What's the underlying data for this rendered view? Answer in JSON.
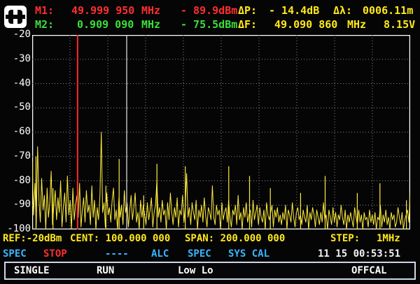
{
  "header": {
    "m1_label": "M1:",
    "m1_freq": "49.999 950",
    "m1_freq_unit": "MHz",
    "m1_level": "- 89.9dBm",
    "delta_p_label": "ΔP:",
    "delta_p_value": "- 14.4dB",
    "delta_lambda_label": "Δλ:",
    "delta_lambda_value": "0006.11m",
    "m2_label": "M2:",
    "m2_freq": "0.909 090",
    "m2_freq_unit": "MHz",
    "m2_level": "- 75.5dBm",
    "delta_f_label": "ΔF:",
    "delta_f_value": "49.090 860",
    "delta_f_unit": "MHz",
    "battery_voltage": "8.15V"
  },
  "chart_data": {
    "type": "line",
    "title": "",
    "xlabel": "",
    "ylabel": "",
    "y_ticks": [
      "-20",
      "-30",
      "-40",
      "-50",
      "-60",
      "-70",
      "-80",
      "-90",
      "-100"
    ],
    "ylim": [
      -100,
      -20
    ],
    "xlim": [
      0,
      200
    ],
    "grid": true,
    "series": [
      {
        "values": [
          -72,
          -94,
          -81,
          -99,
          -66,
          -88,
          -97,
          -79,
          -92,
          -86,
          -100,
          -83,
          -95,
          -89,
          -76,
          -98,
          -90,
          -84,
          -96,
          -87,
          -93,
          -80,
          -99,
          -91,
          -85,
          -97,
          -78,
          -94,
          -88,
          -100,
          -83,
          -96,
          -90,
          -86,
          -95,
          -81,
          -99,
          -92,
          -87,
          -97,
          -84,
          -93,
          -90,
          -98,
          -82,
          -95,
          -88,
          -100,
          -91,
          -96,
          -86,
          -60,
          -93,
          -89,
          -99,
          -85,
          -94,
          -91,
          -97,
          -88,
          -83,
          -96,
          -92,
          -100,
          -87,
          -95,
          -90,
          -98,
          -84,
          -93,
          -89,
          -99,
          -92,
          -86,
          -96,
          -91,
          -85,
          -97,
          -93,
          -100,
          -88,
          -95,
          -90,
          -94,
          -98,
          -89,
          -96,
          -92,
          -87,
          -99,
          -93,
          -90,
          -80,
          -95,
          -91,
          -97,
          -88,
          -94,
          -92,
          -100,
          -89,
          -96,
          -85,
          -93,
          -98,
          -91,
          -95,
          -87,
          -99,
          -92,
          -94,
          -86,
          -97,
          -90,
          -77,
          -95,
          -91,
          -98,
          -89,
          -93,
          -96,
          -88,
          -100,
          -92,
          -95,
          -90,
          -97,
          -87,
          -94,
          -99,
          -91,
          -93,
          -96,
          -82,
          -95,
          -98,
          -90,
          -94,
          -92,
          -100,
          -89,
          -96,
          -93,
          -91,
          -97,
          -88,
          -95,
          -99,
          -92,
          -94,
          -90,
          -98,
          -86,
          -96,
          -93,
          -100,
          -91,
          -95,
          -89,
          -97,
          -94,
          -92,
          -99,
          -88,
          -96,
          -93,
          -90,
          -98,
          -91,
          -95,
          -97,
          -92,
          -100,
          -89,
          -94,
          -96,
          -93,
          -90,
          -99,
          -92,
          -95,
          -91,
          -97,
          -94,
          -98,
          -93,
          -96,
          -90,
          -100,
          -92,
          -94,
          -97,
          -89,
          -95,
          -99,
          -93,
          -91,
          -96,
          -94,
          -98,
          -92,
          -95,
          -97,
          -90,
          -100,
          -93,
          -96,
          -91,
          -94,
          -99,
          -92,
          -95,
          -98,
          -93,
          -97,
          -89,
          -96,
          -94,
          -100,
          -92,
          -95,
          -98,
          -91,
          -97,
          -93,
          -99,
          -94,
          -96,
          -90,
          -95,
          -98,
          -92,
          -100,
          -94,
          -97,
          -93,
          -96,
          -99,
          -91,
          -95,
          -98,
          -92,
          -97,
          -94,
          -100,
          -93,
          -96,
          -95,
          -99,
          -92,
          -97,
          -94,
          -98,
          -93,
          -100,
          -95,
          -96,
          -90,
          -99,
          -94,
          -97,
          -92,
          -98,
          -95,
          -100,
          -93,
          -96,
          -94,
          -99,
          -97,
          -91,
          -95,
          -98,
          -93,
          -100,
          -96,
          -94,
          -92,
          -97,
          -85
        ]
      }
    ],
    "peaks": [
      {
        "x": 2,
        "y": -70
      },
      {
        "x": 11,
        "y": -83
      },
      {
        "x": 24,
        "y": -54
      },
      {
        "x": 39,
        "y": -82
      },
      {
        "x": 46,
        "y": -71
      },
      {
        "x": 59,
        "y": -86
      },
      {
        "x": 66,
        "y": -73
      },
      {
        "x": 81,
        "y": -74
      },
      {
        "x": 104,
        "y": -74
      },
      {
        "x": 115,
        "y": -78
      },
      {
        "x": 126,
        "y": -83
      },
      {
        "x": 142,
        "y": -85
      },
      {
        "x": 155,
        "y": -78
      },
      {
        "x": 172,
        "y": -85
      },
      {
        "x": 184,
        "y": -81
      },
      {
        "x": 198,
        "y": -88
      }
    ],
    "marker_m1_x": 24,
    "marker_m2_x": 50,
    "colors": {
      "trace": "#ffec3c",
      "marker1": "#ff2a2a",
      "marker2": "#e8e8e8",
      "grid": "#8a8a8a",
      "frame": "#ffffff"
    }
  },
  "status": {
    "ref": "REF:-20dBm",
    "cent": "CENT: 100.000 000",
    "span": "SPAN: 200.000 000",
    "step": "STEP:",
    "step_value": "1MHz",
    "mode": "SPEC",
    "stop": "STOP",
    "dashes": "----",
    "alc": "ALC",
    "spec2": "SPEC",
    "syscal": "SYS CAL",
    "datetime": "11 15 00:53:51"
  },
  "softkeys": {
    "k1": "SINGLE",
    "k2": "RUN",
    "k3": "Low Lo",
    "k4": "OFFCAL"
  },
  "logo_icon": "dc-logo-icon"
}
